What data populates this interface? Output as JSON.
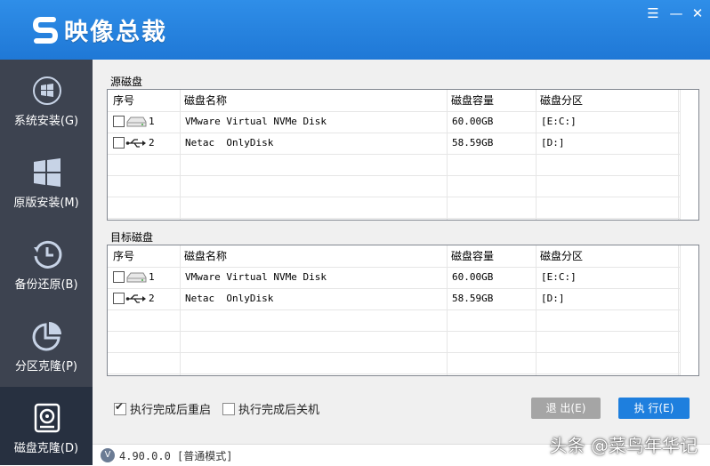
{
  "app": {
    "title": "映像总裁",
    "version_text": "4.90.0.0 [普通模式]",
    "version_badge": "V",
    "window_controls": [
      "menu-icon",
      "minimize-icon",
      "close-icon"
    ]
  },
  "sidebar": {
    "items": [
      {
        "label": "系统安装(G)",
        "icon": "windows-logo-icon",
        "active": false
      },
      {
        "label": "原版安装(M)",
        "icon": "windows-tiles-icon",
        "active": false
      },
      {
        "label": "备份还原(B)",
        "icon": "clock-restore-icon",
        "active": false
      },
      {
        "label": "分区克隆(P)",
        "icon": "pie-chart-icon",
        "active": false
      },
      {
        "label": "磁盘克隆(D)",
        "icon": "disk-clone-icon",
        "active": true
      }
    ]
  },
  "source": {
    "title": "源磁盘",
    "columns": [
      "序号",
      "磁盘名称",
      "磁盘容量",
      "磁盘分区"
    ],
    "rows": [
      {
        "index": "1",
        "type": "hdd",
        "name": "VMware Virtual NVMe Disk",
        "capacity": "60.00GB",
        "partitions": "[E:C:]",
        "checked": false
      },
      {
        "index": "2",
        "type": "usb",
        "name": "Netac  OnlyDisk",
        "capacity": "58.59GB",
        "partitions": "[D:]",
        "checked": false
      }
    ]
  },
  "target": {
    "title": "目标磁盘",
    "columns": [
      "序号",
      "磁盘名称",
      "磁盘容量",
      "磁盘分区"
    ],
    "rows": [
      {
        "index": "1",
        "type": "hdd",
        "name": "VMware Virtual NVMe Disk",
        "capacity": "60.00GB",
        "partitions": "[E:C:]",
        "checked": false
      },
      {
        "index": "2",
        "type": "usb",
        "name": "Netac  OnlyDisk",
        "capacity": "58.59GB",
        "partitions": "[D:]",
        "checked": false
      }
    ]
  },
  "options": {
    "reboot_label": "执行完成后重启",
    "reboot_checked": true,
    "shutdown_label": "执行完成后关机",
    "shutdown_checked": false
  },
  "buttons": {
    "exit_label": "退 出(E)",
    "run_label": "执 行(E)"
  },
  "watermark": "头条 @菜鸟年华记",
  "colors": {
    "titlebar": "#1f78d6",
    "sidebar": "#3d4350",
    "sidebar_active": "#273040",
    "run_button": "#1e7fde",
    "exit_button": "#a5a5a5"
  }
}
